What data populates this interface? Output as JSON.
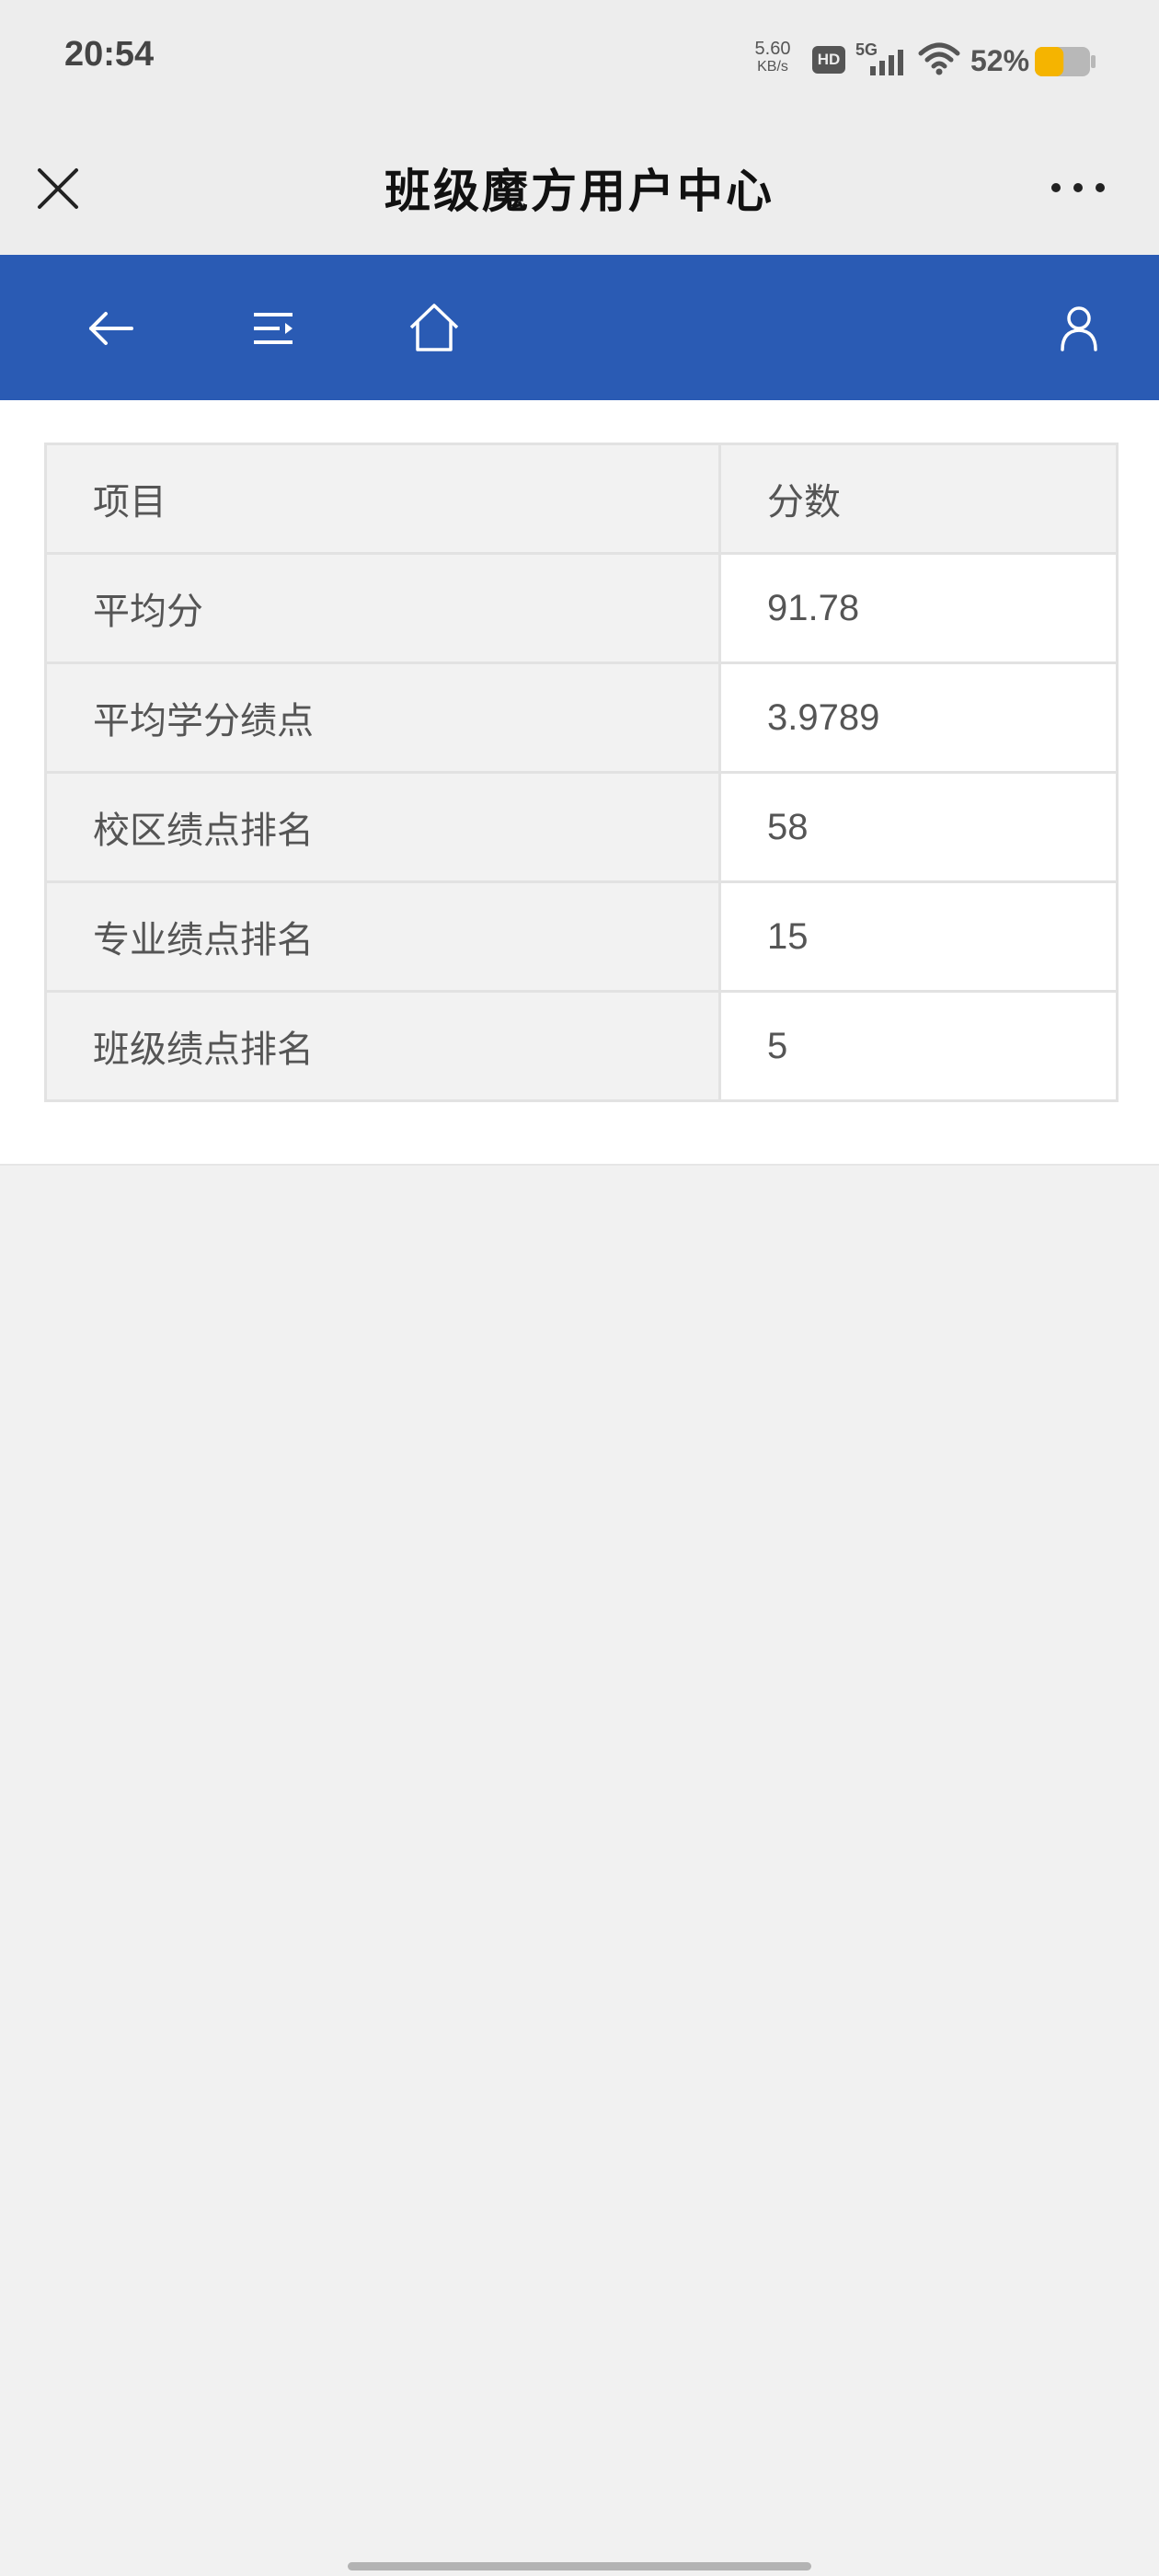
{
  "status_bar": {
    "time": "20:54",
    "net_speed_value": "5.60",
    "net_speed_unit": "KB/s",
    "hd_badge": "HD",
    "network_type": "5G",
    "battery_percent": "52%",
    "battery_level": 0.52,
    "battery_color": "#f5b400"
  },
  "title_bar": {
    "title": "班级魔方用户中心",
    "close_icon": "close-icon",
    "more_icon": "more-options-icon"
  },
  "toolbar": {
    "color": "#2a5bb4",
    "icons": [
      "back-arrow-icon",
      "menu-icon",
      "home-icon",
      "user-icon"
    ]
  },
  "table": {
    "headers": [
      "项目",
      "分数"
    ],
    "rows": [
      {
        "item": "平均分",
        "score": "91.78"
      },
      {
        "item": "平均学分绩点",
        "score": "3.9789"
      },
      {
        "item": "校区绩点排名",
        "score": "58"
      },
      {
        "item": "专业绩点排名",
        "score": "15"
      },
      {
        "item": "班级绩点排名",
        "score": "5"
      }
    ]
  }
}
